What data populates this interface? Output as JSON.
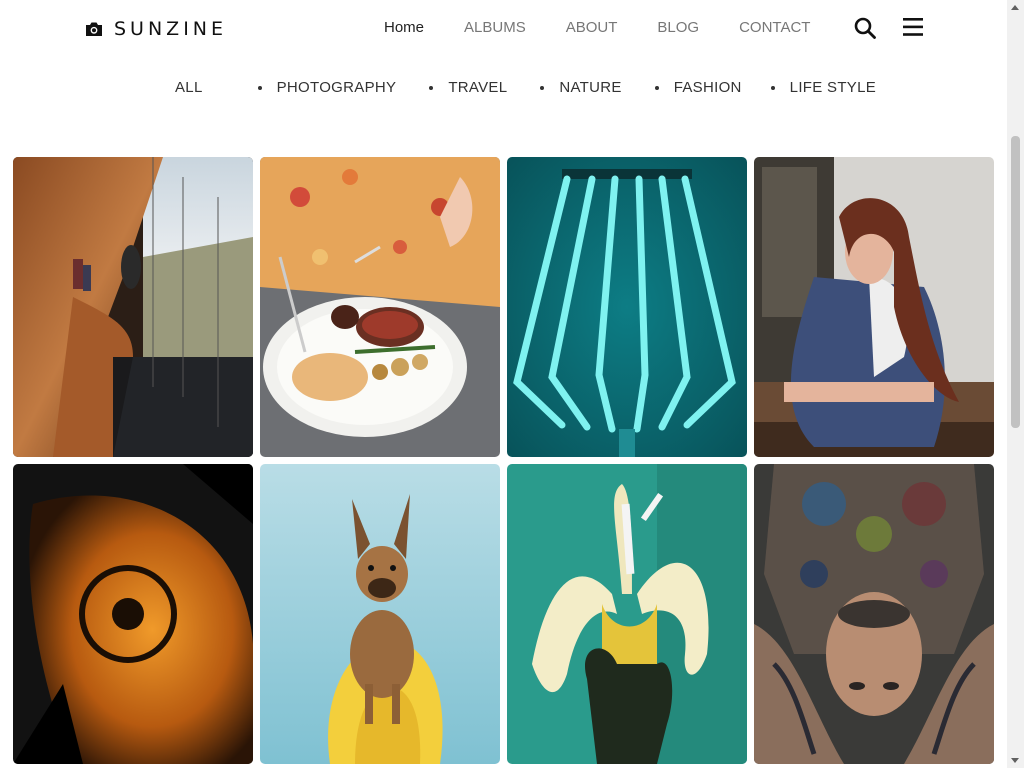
{
  "brand": {
    "name": "SUNZINE",
    "icon": "camera-icon"
  },
  "nav": {
    "items": [
      {
        "label": "Home",
        "active": true
      },
      {
        "label": "ALBUMS",
        "active": false
      },
      {
        "label": "ABOUT",
        "active": false
      },
      {
        "label": "BLOG",
        "active": false
      },
      {
        "label": "CONTACT",
        "active": false
      }
    ],
    "search_icon": "search-icon",
    "menu_icon": "hamburger-menu-icon"
  },
  "filters": {
    "items": [
      "ALL",
      "PHOTOGRAPHY",
      "TRAVEL",
      "NATURE",
      "FASHION",
      "LIFE STYLE"
    ]
  },
  "gallery": {
    "photos": [
      {
        "subject": "wooden-interior-window"
      },
      {
        "subject": "steak-plate"
      },
      {
        "subject": "teal-lamp"
      },
      {
        "subject": "woman-portrait"
      },
      {
        "subject": "harley-davidson-tank"
      },
      {
        "subject": "dog-on-kayak"
      },
      {
        "subject": "banana-cigarette"
      },
      {
        "subject": "tattooed-man"
      }
    ]
  },
  "colors": {
    "text_dark": "#222222",
    "text_muted": "#777777",
    "background": "#ffffff"
  }
}
